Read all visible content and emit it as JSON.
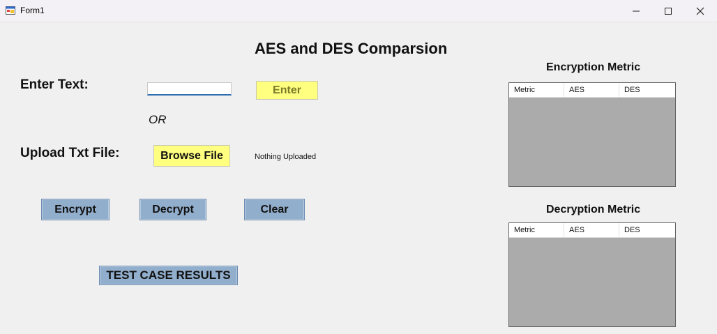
{
  "window": {
    "title": "Form1",
    "icons": [
      "form-app-icon",
      "minimize-icon",
      "maximize-icon",
      "close-icon"
    ]
  },
  "main": {
    "heading": "AES and DES Comparsion",
    "enter_text_label": "Enter Text:",
    "text_input_value": "",
    "enter_button": "Enter",
    "or_label": "OR",
    "upload_label": "Upload Txt File:",
    "browse_button": "Browse File",
    "upload_status": "Nothing Uploaded",
    "encrypt_button": "Encrypt",
    "decrypt_button": "Decrypt",
    "clear_button": "Clear",
    "test_case_button": "TEST CASE RESULTS"
  },
  "encryption_metric": {
    "title": "Encryption Metric",
    "columns": [
      "Metric",
      "AES",
      "DES"
    ]
  },
  "decryption_metric": {
    "title": "Decryption Metric",
    "columns": [
      "Metric",
      "AES",
      "DES"
    ]
  },
  "colors": {
    "window_bg": "#f0f0f0",
    "yellow_button": "#ffff80",
    "blue_button": "#92aecd",
    "grid_bg": "#ababab"
  }
}
